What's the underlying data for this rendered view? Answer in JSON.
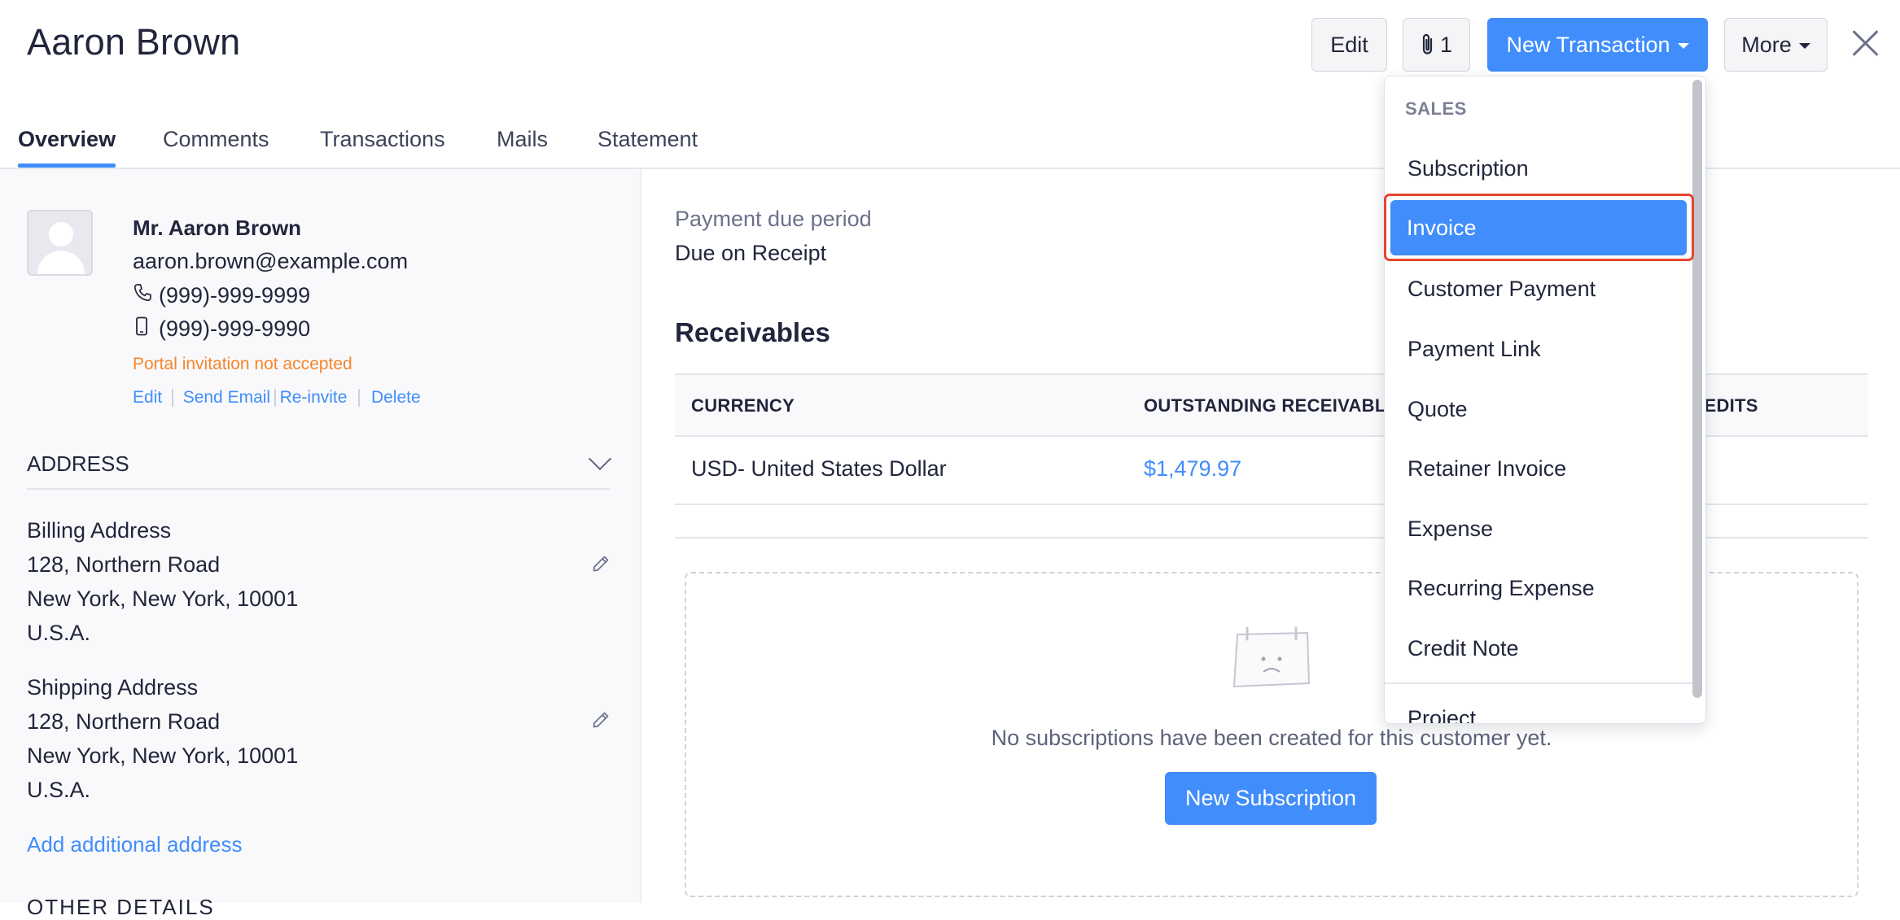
{
  "header": {
    "title": "Aaron Brown",
    "edit_label": "Edit",
    "attachments_count": "1",
    "new_transaction_label": "New Transaction",
    "more_label": "More"
  },
  "tabs": [
    {
      "label": "Overview",
      "active": true
    },
    {
      "label": "Comments"
    },
    {
      "label": "Transactions"
    },
    {
      "label": "Mails"
    },
    {
      "label": "Statement"
    }
  ],
  "contact": {
    "name": "Mr. Aaron Brown",
    "email": "aaron.brown@example.com",
    "phone": "(999)-999-9999",
    "mobile": "(999)-999-9990",
    "portal_status": "Portal invitation not accepted",
    "actions": [
      "Edit",
      "Send Email",
      "Re-invite",
      "Delete"
    ]
  },
  "address": {
    "section_label": "ADDRESS",
    "billing": {
      "label": "Billing Address",
      "line1": "128, Northern Road",
      "line2": "New York, New York, 10001",
      "line3": "U.S.A."
    },
    "shipping": {
      "label": "Shipping Address",
      "line1": "128, Northern Road",
      "line2": "New York, New York, 10001",
      "line3": "U.S.A."
    },
    "add_link": "Add additional address",
    "next_section": "OTHER DETAILS"
  },
  "payment": {
    "label": "Payment due period",
    "value": "Due on Receipt"
  },
  "receivables": {
    "title": "Receivables",
    "columns": [
      "CURRENCY",
      "OUTSTANDING RECEIVABLE",
      "UNUSED CREDITS"
    ],
    "rows": [
      {
        "currency": "USD- United States Dollar",
        "outstanding": "$1,479.97"
      }
    ]
  },
  "subscriptions": {
    "empty_text": "No subscriptions have been created for this customer yet.",
    "button_label": "New Subscription"
  },
  "dropdown": {
    "header": "SALES",
    "items": [
      "Subscription",
      "Invoice",
      "Customer Payment",
      "Payment Link",
      "Quote",
      "Retainer Invoice",
      "Expense",
      "Recurring Expense",
      "Credit Note",
      "Project"
    ],
    "selected": "Invoice"
  },
  "colors": {
    "accent": "#408dfb",
    "warning": "#f5852c",
    "highlight_border": "#e8442d"
  }
}
